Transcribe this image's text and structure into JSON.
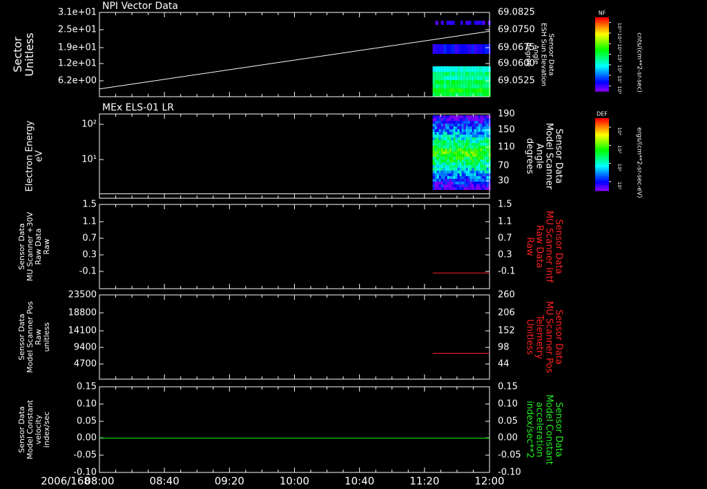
{
  "figure": {
    "date_label": "2006/168",
    "time_ticks": [
      "08:00",
      "08:40",
      "09:20",
      "10:00",
      "10:40",
      "11:20",
      "12:00"
    ]
  },
  "colorbars": [
    {
      "tag": "NF",
      "scale_labels": [
        "10¹²",
        "10¹¹",
        "10¹⁰",
        "10⁹",
        "10⁸",
        "10⁷",
        "10⁶"
      ],
      "unit_label": "cnts/(cm**2-sr-sec)"
    },
    {
      "tag": "DEF",
      "scale_labels": [
        "10⁴",
        "10³",
        "10²",
        "10¹"
      ],
      "unit_label": "ergs/(cm**2-sr-sec-eV)"
    }
  ],
  "chart_data": [
    {
      "type": "line",
      "title": "NPI Vector Data",
      "left_axis": {
        "label_lines": [
          "Sector",
          "Unitless"
        ],
        "ticks": [
          "3.1e+01",
          "2.5e+01",
          "1.9e+01",
          "1.2e+01",
          "6.2e+00"
        ],
        "color": "#ffffff"
      },
      "right_axis": {
        "label_lines": [
          "Sensor Data",
          "ESH Sun Elevation",
          "Angle",
          "degree"
        ],
        "ticks": [
          "69.0825",
          "69.0750",
          "69.0675",
          "69.0600",
          "69.0525"
        ],
        "range": [
          69.046,
          69.084
        ],
        "color": "#ffffff"
      },
      "series": [
        {
          "color": "#ffffff",
          "x": [
            "08:00",
            "12:00"
          ],
          "y": [
            69.0495,
            69.0755
          ]
        }
      ],
      "spectrogram": {
        "start": "11:25",
        "end": "12:00",
        "colorbar": "NF"
      }
    },
    {
      "type": "line",
      "title": "MEx ELS-01 LR",
      "left_axis": {
        "label_lines": [
          "Electron Energy",
          "eV"
        ],
        "ticks": [
          "10²",
          "10¹"
        ],
        "scale": "log",
        "color": "#ffffff"
      },
      "right_axis": {
        "label_lines": [
          "Sensor Data",
          "Model Scanner",
          "Angle",
          "degrees"
        ],
        "ticks": [
          "190",
          "150",
          "110",
          "70",
          "30"
        ],
        "range": [
          0,
          190
        ],
        "color": "#ffffff"
      },
      "series": [
        {
          "color": "#ffffff",
          "x": [
            "08:00",
            "12:00"
          ],
          "y": [
            10,
            10
          ]
        }
      ],
      "spectrogram": {
        "start": "11:25",
        "end": "12:00",
        "colorbar": "DEF"
      }
    },
    {
      "type": "line",
      "left_axis": {
        "label_lines": [
          "Sensor Data",
          "MU Scanner +30V",
          "Raw Data",
          "Raw"
        ],
        "ticks": [
          "1.5",
          "1.1",
          "0.7",
          "0.3",
          "-0.1"
        ],
        "color": "#ffffff"
      },
      "right_axis": {
        "label_lines": [
          "Sensor Data",
          "MU Scanner Intf",
          "Raw Data",
          "Raw"
        ],
        "ticks": [
          "1.5",
          "1.1",
          "0.7",
          "0.3",
          "-0.1"
        ],
        "range": [
          -0.38,
          1.5
        ],
        "color": "#ff2020"
      },
      "series": [
        {
          "color": "#ff2020",
          "x": [
            "11:25",
            "12:00"
          ],
          "y": [
            -0.03,
            -0.03
          ]
        }
      ]
    },
    {
      "type": "line",
      "left_axis": {
        "label_lines": [
          "Sensor Data",
          "Model Scanner Pos",
          "Raw",
          "unitless"
        ],
        "ticks": [
          "23500",
          "18800",
          "14100",
          "9400",
          "4700"
        ],
        "color": "#ffffff"
      },
      "right_axis": {
        "label_lines": [
          "Sensor Data",
          "MU Scanner Pos",
          "Telemetry",
          "Unitless"
        ],
        "ticks": [
          "260",
          "206",
          "152",
          "98",
          "44"
        ],
        "range": [
          0,
          260
        ],
        "color": "#ff2020"
      },
      "series": [
        {
          "color": "#ff2020",
          "x": [
            "11:25",
            "12:00"
          ],
          "y": [
            80,
            80
          ]
        }
      ]
    },
    {
      "type": "line",
      "left_axis": {
        "label_lines": [
          "Sensor Data",
          "Model Constant",
          "velocity",
          "index/sec"
        ],
        "ticks": [
          "0.15",
          "0.10",
          "0.05",
          "0.00",
          "-0.05",
          "-0.10"
        ],
        "color": "#ffffff"
      },
      "right_axis": {
        "label_lines": [
          "Sensor Data",
          "Model Constant",
          "acceleration",
          "index/sec**2"
        ],
        "ticks": [
          "0.15",
          "0.10",
          "0.05",
          "0.00",
          "-0.05",
          "-0.10"
        ],
        "range": [
          -0.1,
          0.15
        ],
        "color": "#22ee22"
      },
      "series": [
        {
          "color": "#22ee22",
          "x": [
            "08:00",
            "12:00"
          ],
          "y": [
            0.0,
            0.0
          ]
        }
      ]
    }
  ]
}
